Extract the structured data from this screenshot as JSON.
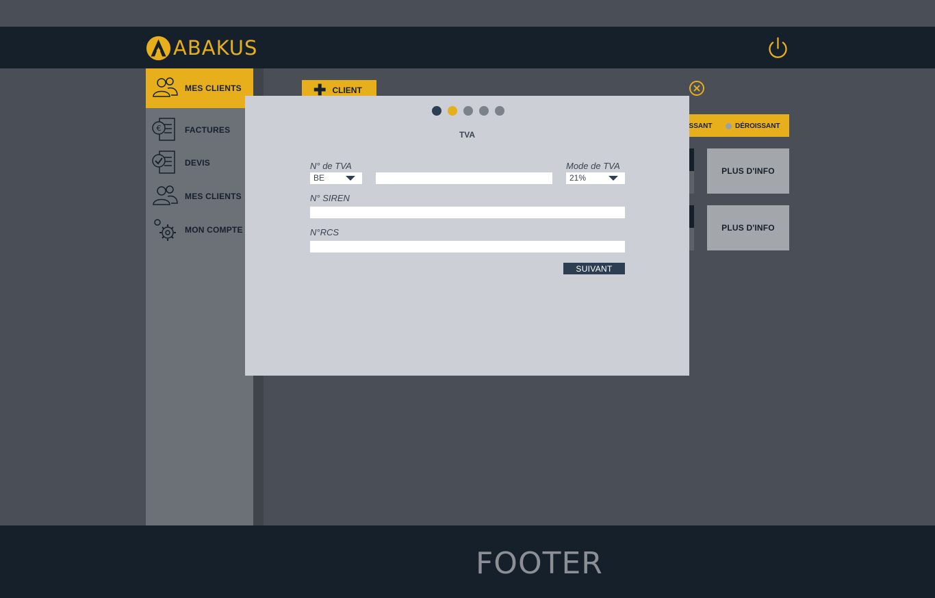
{
  "header": {
    "brand": "ABAKUS"
  },
  "sidebar": {
    "items": [
      {
        "label": "MES CLIENTS"
      },
      {
        "label": "FACTURES"
      },
      {
        "label": "DEVIS"
      },
      {
        "label": "MES CLIENTS"
      },
      {
        "label": "MON COMPTE"
      }
    ]
  },
  "main": {
    "add_button": {
      "label": "CLIENT"
    },
    "sort": {
      "option_1": "OISSANT",
      "option_2": "DÉROISSANT"
    },
    "cards": [
      {
        "button": "PLUS D'INFO"
      },
      {
        "button": "PLUS D'INFO"
      }
    ]
  },
  "modal": {
    "steps": {
      "total": 5,
      "current": 2
    },
    "title": "TVA",
    "fields": {
      "tva_label": "N° de TVA",
      "tva_country": "BE",
      "tva_number": "",
      "tva_mode_label": "Mode de TVA",
      "tva_mode": "21%",
      "siren_label": "N° SIREN",
      "siren": "",
      "rcs_label": "N°RCS",
      "rcs": ""
    },
    "next_label": "SUIVANT"
  },
  "footer": {
    "text": "FOOTER"
  },
  "colors": {
    "accent": "#e7af1c",
    "dark": "#16202b",
    "navy": "#2d3e52"
  }
}
